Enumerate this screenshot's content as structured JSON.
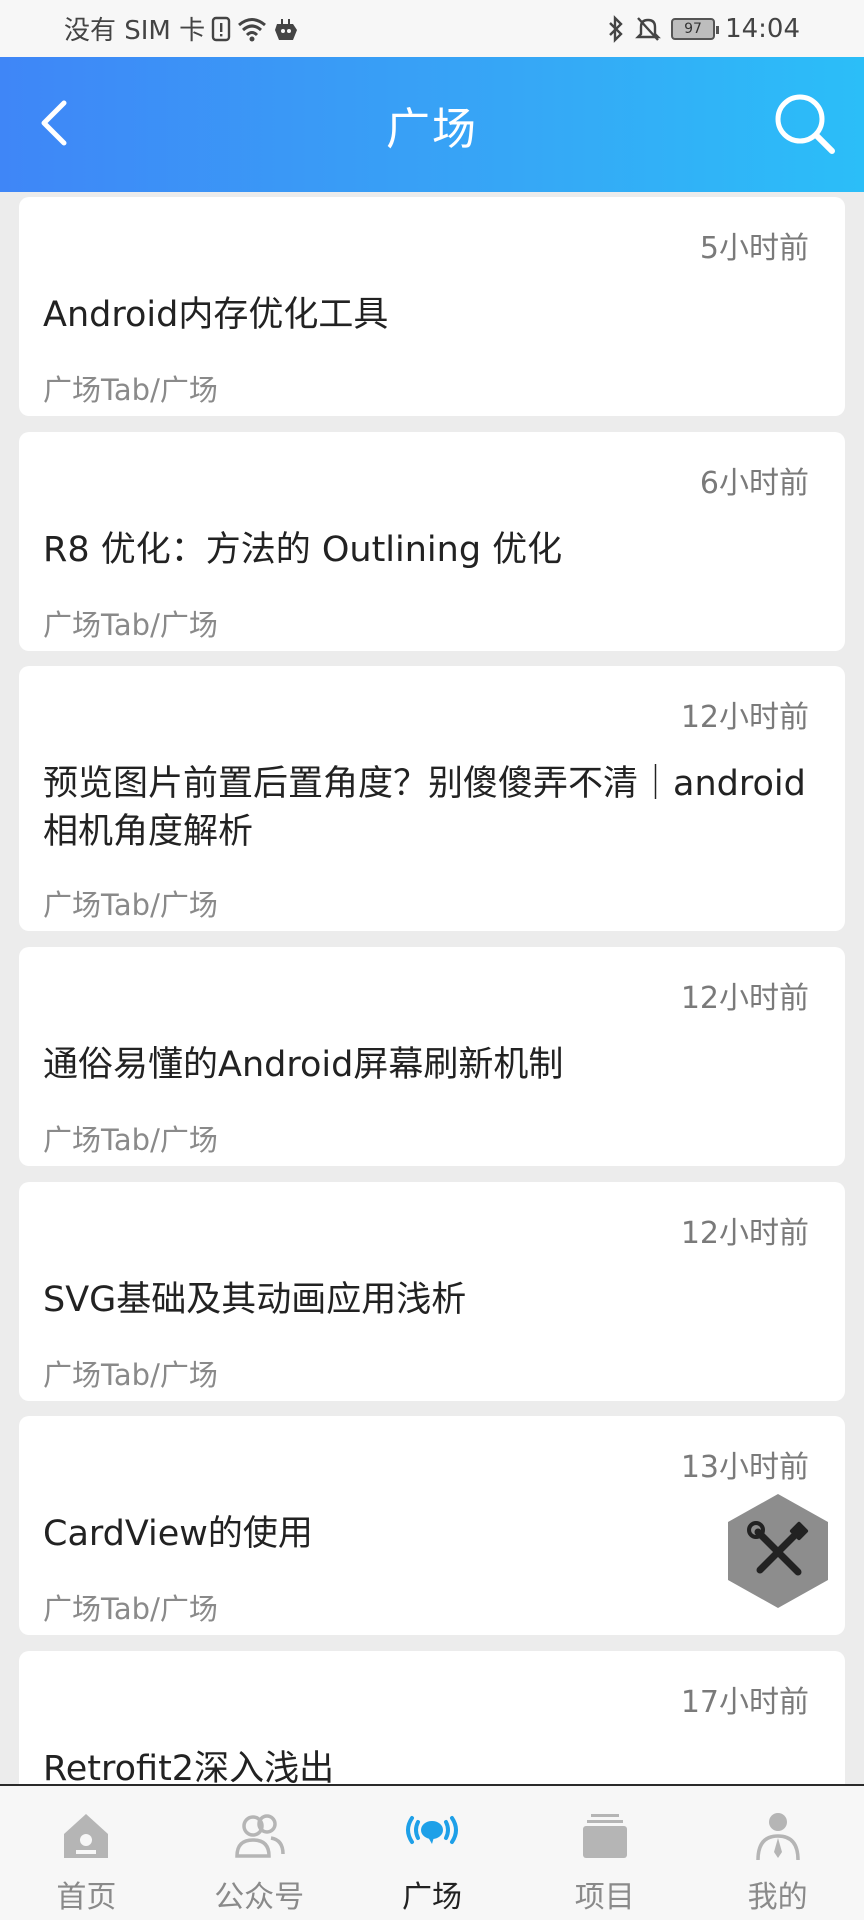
{
  "status_bar": {
    "carrier": "没有 SIM 卡",
    "battery": "97",
    "time": "14:04"
  },
  "app_bar": {
    "title": "广场",
    "back_icon": "chevron-left-icon",
    "search_icon": "search-icon"
  },
  "articles": [
    {
      "time": "5小时前",
      "title": "Android内存优化工具",
      "tag": "广场Tab/广场"
    },
    {
      "time": "6小时前",
      "title": "R8 优化：方法的 Outlining 优化",
      "tag": "广场Tab/广场"
    },
    {
      "time": "12小时前",
      "title": "预览图片前置后置角度？别傻傻弄不清｜android相机角度解析",
      "tag": "广场Tab/广场"
    },
    {
      "time": "12小时前",
      "title": "通俗易懂的Android屏幕刷新机制",
      "tag": "广场Tab/广场"
    },
    {
      "time": "12小时前",
      "title": "SVG基础及其动画应用浅析",
      "tag": "广场Tab/广场"
    },
    {
      "time": "13小时前",
      "title": "CardView的使用",
      "tag": "广场Tab/广场"
    },
    {
      "time": "17小时前",
      "title": "Retrofit2深入浅出",
      "tag": ""
    }
  ],
  "fab": {
    "icon": "tools-icon"
  },
  "bottom_nav": [
    {
      "label": "首页",
      "icon": "home-icon",
      "active": false
    },
    {
      "label": "公众号",
      "icon": "people-icon",
      "active": false
    },
    {
      "label": "广场",
      "icon": "broadcast-chat-icon",
      "active": true
    },
    {
      "label": "项目",
      "icon": "stack-icon",
      "active": false
    },
    {
      "label": "我的",
      "icon": "person-icon",
      "active": false
    }
  ],
  "colors": {
    "app_bar_start": "#3f86f7",
    "app_bar_end": "#2bbef8",
    "active_nav": "#1ea0e8",
    "inactive_nav": "#b5b5b5"
  }
}
